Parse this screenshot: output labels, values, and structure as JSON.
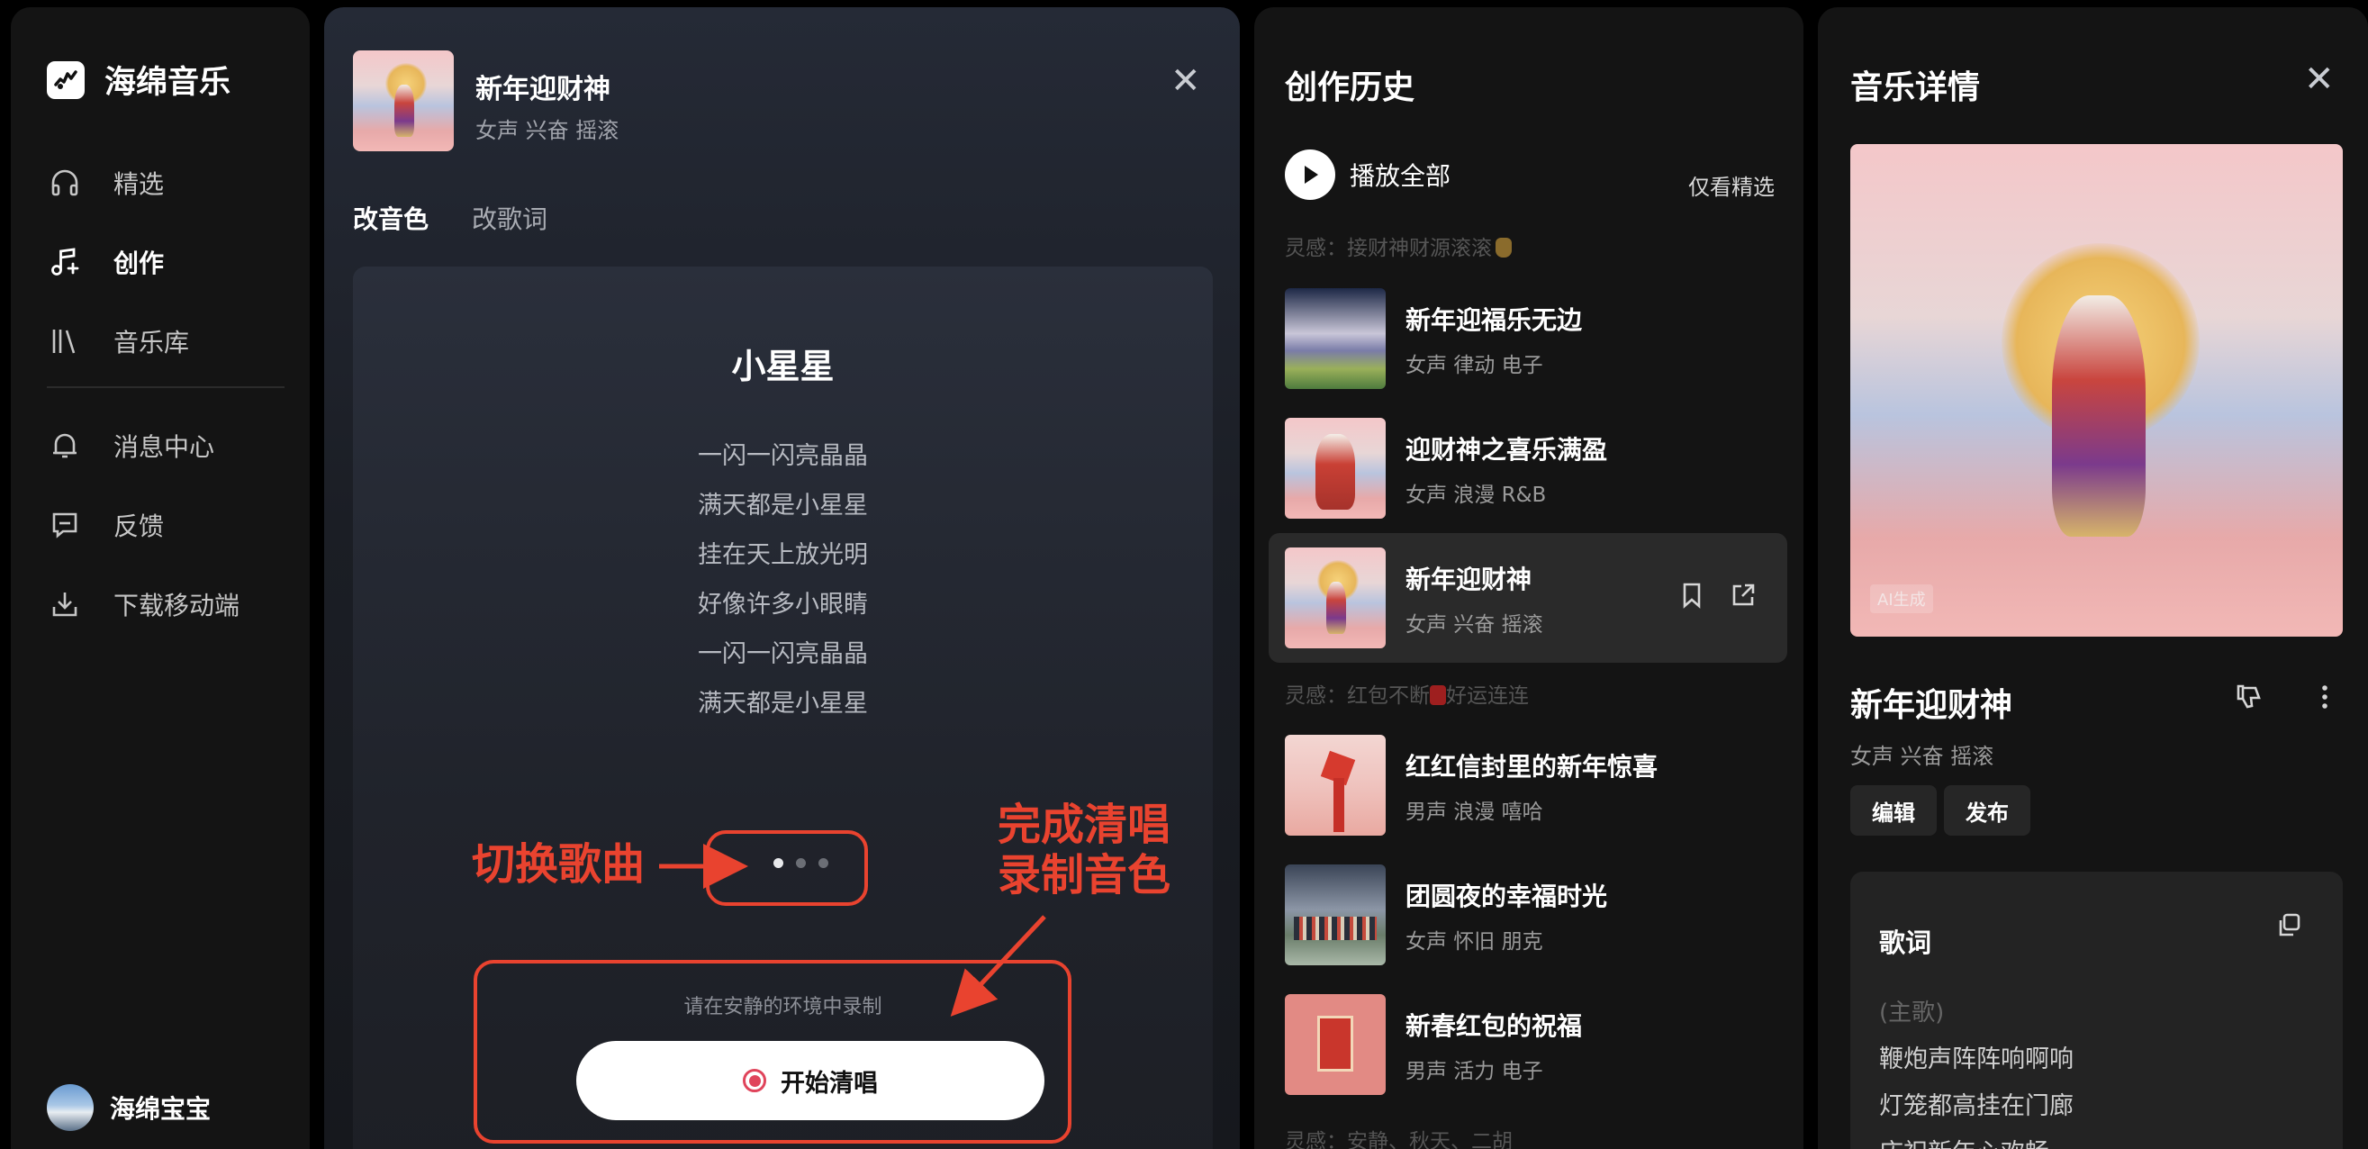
{
  "app": {
    "name": "海绵音乐"
  },
  "nav": {
    "items": [
      {
        "label": "精选",
        "icon": "headphones-icon"
      },
      {
        "label": "创作",
        "icon": "music-note-sparkle-icon"
      },
      {
        "label": "音乐库",
        "icon": "library-icon"
      },
      {
        "label": "消息中心",
        "icon": "bell-icon"
      },
      {
        "label": "反馈",
        "icon": "feedback-icon"
      },
      {
        "label": "下载移动端",
        "icon": "download-icon"
      }
    ],
    "active": "创作"
  },
  "user": {
    "name": "海绵宝宝"
  },
  "voice_panel": {
    "song_title": "新年迎财神",
    "song_tags": "女声 兴奋 摇滚",
    "tabs": [
      "改音色",
      "改歌词"
    ],
    "active_tab": "改音色",
    "lyrics_card": {
      "song_name": "小星星",
      "lines": [
        "一闪一闪亮晶晶",
        "满天都是小星星",
        "挂在天上放光明",
        "好像许多小眼睛",
        "一闪一闪亮晶晶",
        "满天都是小星星"
      ],
      "page_count": 3,
      "current_page": 1,
      "hint": "请在安静的环境中录制",
      "record_button": "开始清唱"
    },
    "annotations": {
      "switch_song": "切换歌曲",
      "finish_line1": "完成清唱",
      "finish_line2": "录制音色"
    }
  },
  "history": {
    "title": "创作历史",
    "play_all": "播放全部",
    "only_picked": "仅看精选",
    "groups": [
      {
        "inspiration": "灵感：接财神财源滚滚",
        "tracks": [
          {
            "title": "新年迎福乐无边",
            "tags": "女声 律动 电子"
          },
          {
            "title": "迎财神之喜乐满盈",
            "tags": "女声 浪漫 R&B"
          },
          {
            "title": "新年迎财神",
            "tags": "女声 兴奋 摇滚"
          }
        ]
      },
      {
        "inspiration_prefix": "灵感：红包不断",
        "inspiration_suffix": "好运连连",
        "tracks": [
          {
            "title": "红红信封里的新年惊喜",
            "tags": "男声 浪漫 嘻哈"
          },
          {
            "title": "团圆夜的幸福时光",
            "tags": "女声 怀旧 朋克"
          },
          {
            "title": "新春红包的祝福",
            "tags": "男声 活力 电子"
          }
        ]
      },
      {
        "inspiration": "灵感：安静、秋天、二胡",
        "tracks": []
      }
    ],
    "selected_track": "新年迎财神"
  },
  "detail": {
    "title": "音乐详情",
    "ai_tag": "AI生成",
    "song_title": "新年迎财神",
    "song_tags": "女声 兴奋 摇滚",
    "buttons": [
      "编辑",
      "发布"
    ],
    "lyrics": {
      "title": "歌词",
      "section": "(主歌)",
      "lines": [
        "鞭炮声阵阵响啊响",
        "灯笼都高挂在门廊",
        "庆祝新年心欢畅"
      ]
    }
  },
  "colors": {
    "annotation": "#e9432f",
    "record_red": "#e0445b",
    "panel_bg": "#141414"
  }
}
